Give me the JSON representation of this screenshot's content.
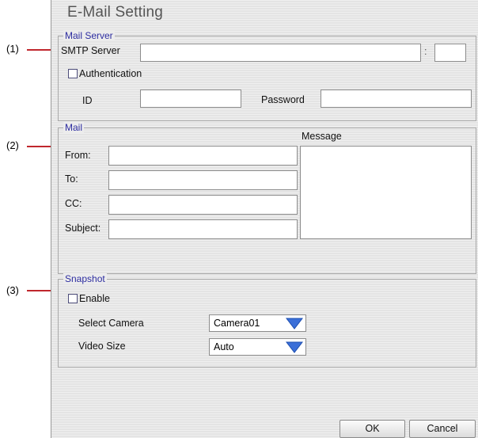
{
  "window": {
    "title": "E-Mail Setting"
  },
  "callouts": [
    "(1)",
    "(2)",
    "(3)"
  ],
  "mail_server": {
    "legend": "Mail Server",
    "smtp_label": "SMTP Server",
    "smtp_value": "",
    "port_separator": ":",
    "port_value": "",
    "authentication_label": "Authentication",
    "authentication_checked": false,
    "id_label": "ID",
    "id_value": "",
    "password_label": "Password",
    "password_value": ""
  },
  "mail": {
    "legend": "Mail",
    "message_label": "Message",
    "from_label": "From:",
    "to_label": "To:",
    "cc_label": "CC:",
    "subject_label": "Subject:"
  },
  "snapshot": {
    "legend": "Snapshot",
    "enable_label": "Enable",
    "enable_checked": false,
    "select_camera_label": "Select Camera",
    "select_camera_value": "Camera01",
    "video_size_label": "Video Size",
    "video_size_value": "Auto"
  },
  "buttons": {
    "ok": "OK",
    "cancel": "Cancel"
  },
  "colors": {
    "legend_text": "#2d2da0",
    "callout_line": "#c0272d",
    "dropdown_arrow": "#3b6fd8"
  }
}
